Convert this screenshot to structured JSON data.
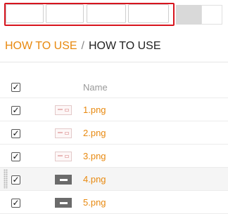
{
  "breadcrumb": {
    "parent": "HOW TO USE",
    "separator": "/",
    "current": "HOW TO USE"
  },
  "table": {
    "header": {
      "name": "Name",
      "checked": true
    },
    "rows": [
      {
        "name": "1.png",
        "checked": true,
        "thumb": "image-thumbnail"
      },
      {
        "name": "2.png",
        "checked": true,
        "thumb": "image-thumbnail"
      },
      {
        "name": "3.png",
        "checked": true,
        "thumb": "image-thumbnail"
      },
      {
        "name": "4.png",
        "checked": true,
        "thumb": "image-thumbnail-dark"
      },
      {
        "name": "5.png",
        "checked": true,
        "thumb": "image-thumbnail-dark"
      }
    ]
  },
  "colors": {
    "accent": "#e8890f",
    "highlight": "#d7141e"
  }
}
